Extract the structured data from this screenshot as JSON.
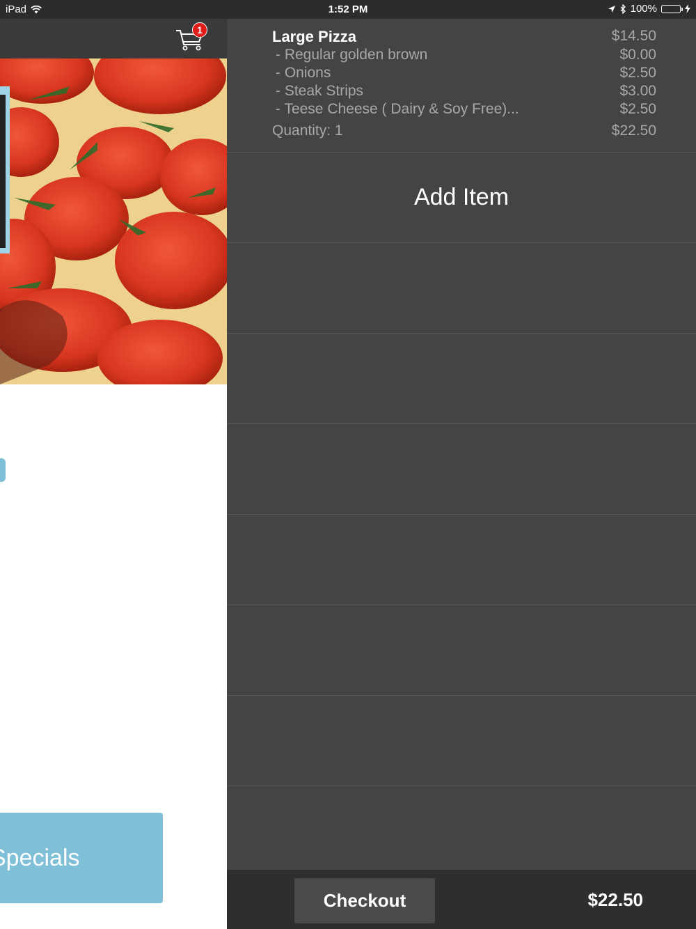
{
  "status_bar": {
    "device": "iPad",
    "time": "1:52 PM",
    "battery": "100%"
  },
  "left": {
    "cart_count": "1",
    "specials_label": "Specials"
  },
  "order": {
    "item_name": "Large  Pizza",
    "item_price": "$14.50",
    "options": [
      {
        "label": "- Regular golden brown",
        "price": "$0.00"
      },
      {
        "label": "- Onions",
        "price": "$2.50"
      },
      {
        "label": "- Steak Strips",
        "price": "$3.00"
      },
      {
        "label": "- Teese Cheese ( Dairy & Soy Free)...",
        "price": "$2.50"
      }
    ],
    "quantity_label": "Quantity: 1",
    "line_total": "$22.50"
  },
  "add_item_label": "Add Item",
  "footer": {
    "checkout_label": "Checkout",
    "total": "$22.50"
  },
  "colors": {
    "accent_blue": "#7fc0d8",
    "panel_bg": "#444444",
    "badge_red": "#e21b1b"
  }
}
